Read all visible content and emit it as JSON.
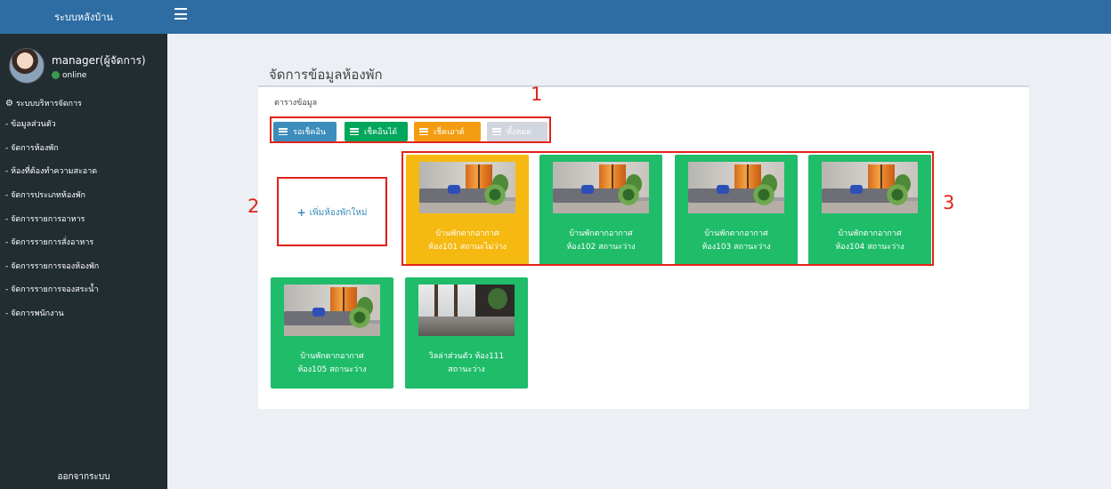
{
  "app": {
    "brand": "ระบบหลังบ้าน",
    "logout": "ออกจากระบบ"
  },
  "user": {
    "name": "manager(ผู้จัดการ)",
    "status": "online"
  },
  "sidebar": {
    "header": "ระบบบริหารจัดการ",
    "items": [
      {
        "label": "- ข้อมูลส่วนตัว"
      },
      {
        "label": "- จัดการห้องพัก"
      },
      {
        "label": "- ห้องที่ต้องทำความสะอาด"
      },
      {
        "label": "- จัดการประเภทห้องพัก"
      },
      {
        "label": "- จัดการรายการอาหาร"
      },
      {
        "label": "- จัดการรายการสั่งอาหาร"
      },
      {
        "label": "- จัดการรายการจองห้องพัก"
      },
      {
        "label": "- จัดการรายการจองสระน้ำ"
      },
      {
        "label": "- จัดการพนักงาน"
      }
    ]
  },
  "page": {
    "title": "จัดการข้อมูลห้องพัก",
    "box_title": "ตารางข้อมูล"
  },
  "filters": {
    "waiting_checkin": "รอเช็คอิน",
    "checkin_available": "เช็คอินได้",
    "checkout": "เช็คเอาต์",
    "all": "ทั้งหมด"
  },
  "add_room": {
    "label": "เพิ่มห้องพักใหม่"
  },
  "rooms": [
    {
      "line1": "บ้านพักตากอากาศ",
      "line2": "ห้อง101 สถานะไม่ว่าง"
    },
    {
      "line1": "บ้านพักตากอากาศ",
      "line2": "ห้อง102 สถานะว่าง"
    },
    {
      "line1": "บ้านพักตากอากาศ",
      "line2": "ห้อง103 สถานะว่าง"
    },
    {
      "line1": "บ้านพักตากอากาศ",
      "line2": "ห้อง104 สถานะว่าง"
    },
    {
      "line1": "บ้านพักตากอากาศ",
      "line2": "ห้อง105 สถานะว่าง"
    },
    {
      "line1": "วิลล่าส่วนตัว ห้อง111",
      "line2": "สถานะว่าง"
    }
  ],
  "annotations": [
    "1",
    "2",
    "3"
  ],
  "colors": {
    "brand_blue": "#2e6da4",
    "sidebar_bg": "#222d32",
    "room_free": "#1fbc6a",
    "room_busy": "#f5b912",
    "annotation_red": "#e2231a"
  }
}
